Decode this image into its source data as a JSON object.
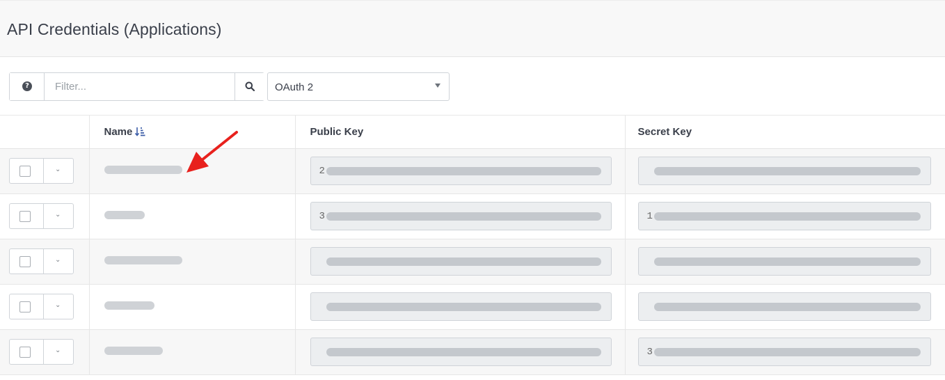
{
  "page": {
    "title": "API Credentials (Applications)"
  },
  "toolbar": {
    "filter_placeholder": "Filter...",
    "auth_type": "OAuth 2",
    "icons": {
      "help": "question-circle-icon",
      "search": "search-icon",
      "dropdown": "caret-down-icon"
    }
  },
  "table": {
    "columns": {
      "name": "Name",
      "public_key": "Public Key",
      "secret_key": "Secret Key"
    },
    "sort": {
      "column": "name",
      "direction": "ascending"
    },
    "rows": [
      {
        "name": "",
        "public_key_prefix": "2",
        "secret_key_prefix": ""
      },
      {
        "name": "",
        "public_key_prefix": "3",
        "secret_key_prefix": "1"
      },
      {
        "name": "",
        "public_key_prefix": "",
        "secret_key_prefix": ""
      },
      {
        "name": "",
        "public_key_prefix": "",
        "secret_key_prefix": ""
      },
      {
        "name": "",
        "public_key_prefix": "",
        "secret_key_prefix": "3"
      }
    ]
  },
  "colors": {
    "accent": "#3d5ea8",
    "annotation_arrow": "#e8211d"
  }
}
